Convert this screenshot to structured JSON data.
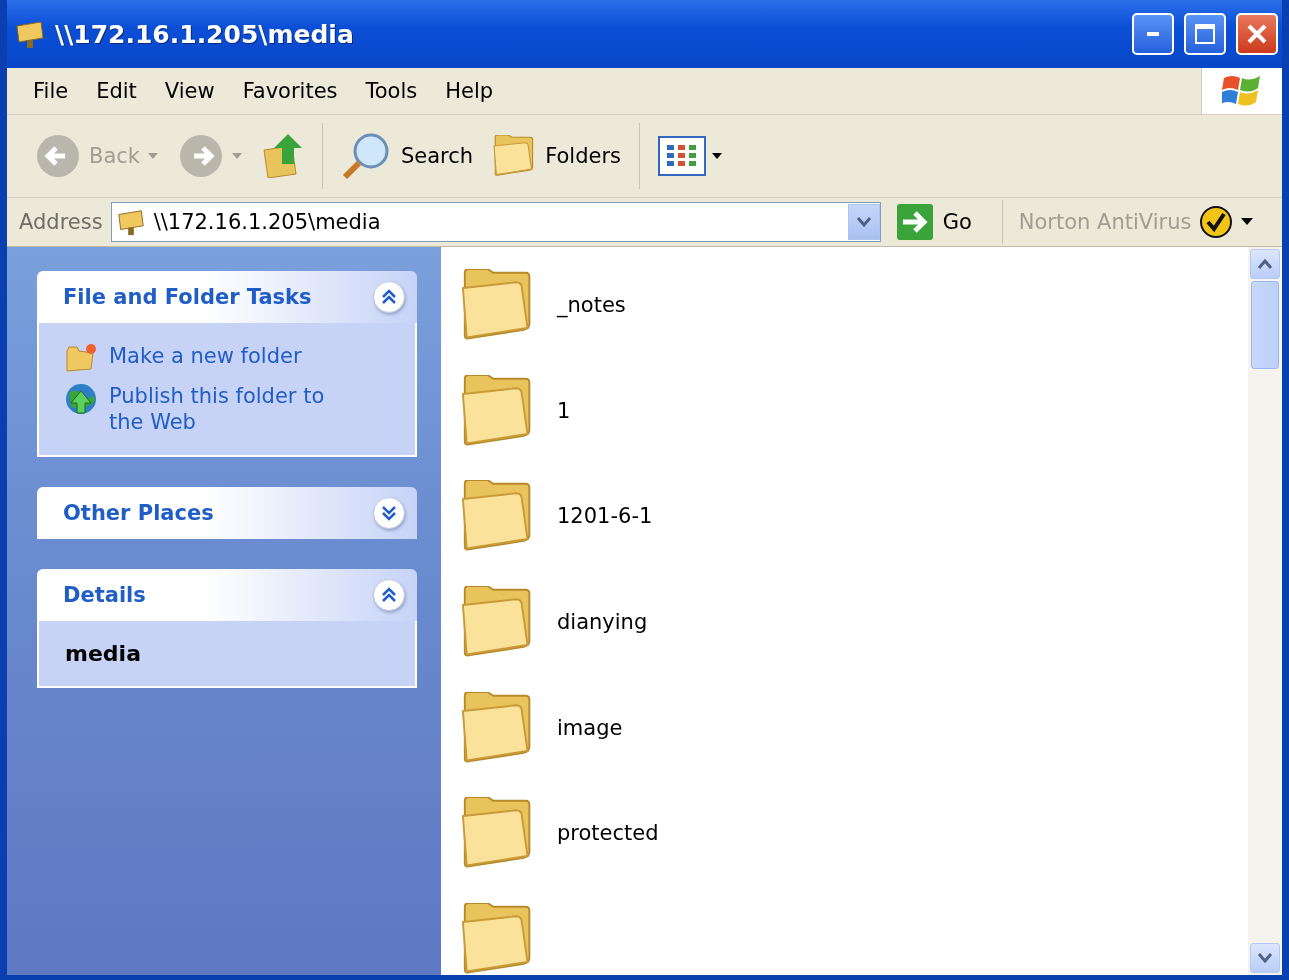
{
  "window": {
    "title": "\\\\172.16.1.205\\media"
  },
  "menu": [
    "File",
    "Edit",
    "View",
    "Favorites",
    "Tools",
    "Help"
  ],
  "toolbar": [
    {
      "kind": "back",
      "label": "Back",
      "disabled": true
    },
    {
      "kind": "forward",
      "disabled": true
    },
    {
      "kind": "up"
    },
    {
      "kind": "search",
      "label": "Search"
    },
    {
      "kind": "folders",
      "label": "Folders"
    },
    {
      "kind": "views"
    }
  ],
  "address": {
    "label": "Address",
    "value": "\\\\172.16.1.205\\media",
    "go": "Go",
    "norton": "Norton AntiVirus"
  },
  "panels": [
    {
      "title": "File and Folder Tasks",
      "expanded": true,
      "tasks": [
        {
          "kind": "newfolder",
          "label": "Make a new folder"
        },
        {
          "kind": "publish",
          "label": "Publish this folder to the Web"
        }
      ]
    },
    {
      "title": "Other Places",
      "expanded": false
    },
    {
      "title": "Details",
      "expanded": true,
      "detail": "media"
    }
  ],
  "folders": [
    {
      "name": "_notes"
    },
    {
      "name": "1"
    },
    {
      "name": "1201-6-1"
    },
    {
      "name": "dianying"
    },
    {
      "name": "image"
    },
    {
      "name": "protected"
    }
  ]
}
